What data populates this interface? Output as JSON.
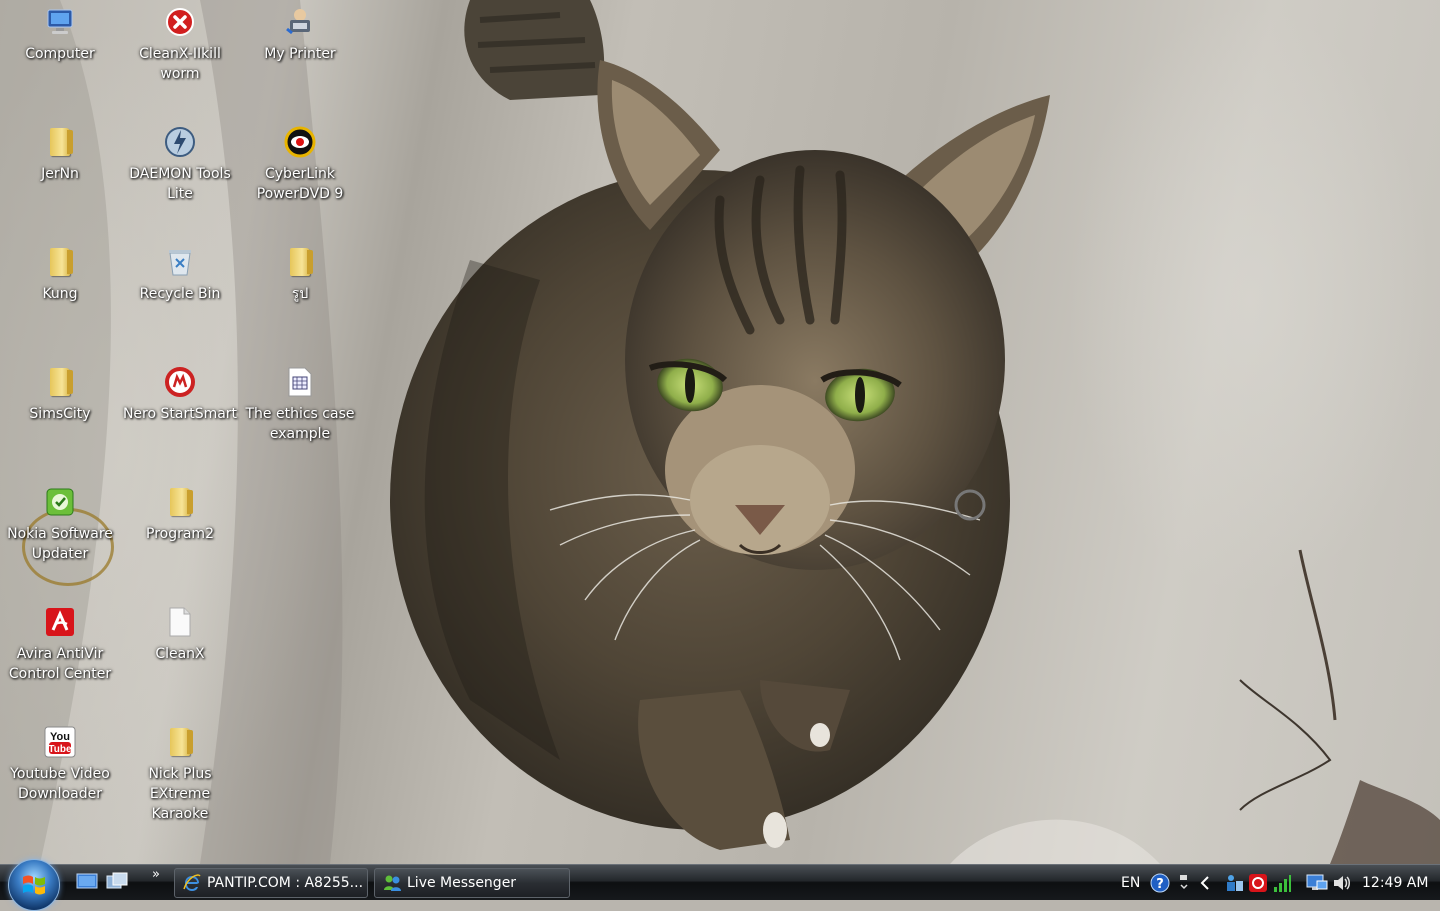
{
  "desktop": {
    "icons": [
      {
        "label": "Computer",
        "icon": "computer-icon"
      },
      {
        "label": "CleanX-IIkill worm",
        "icon": "red-x-icon"
      },
      {
        "label": "My Printer",
        "icon": "printer-icon"
      },
      {
        "label": "JerNn",
        "icon": "folder-icon"
      },
      {
        "label": "DAEMON Tools Lite",
        "icon": "daemon-tools-icon"
      },
      {
        "label": "CyberLink PowerDVD 9",
        "icon": "powerdvd-icon"
      },
      {
        "label": "Kung",
        "icon": "folder-icon"
      },
      {
        "label": "Recycle Bin",
        "icon": "recycle-bin-icon"
      },
      {
        "label": "รูป",
        "icon": "folder-icon"
      },
      {
        "label": "SimsCity",
        "icon": "folder-icon"
      },
      {
        "label": "Nero StartSmart",
        "icon": "nero-icon"
      },
      {
        "label": "The ethics case example",
        "icon": "document-icon"
      },
      {
        "label": "Nokia Software Updater",
        "icon": "nokia-updater-icon"
      },
      {
        "label": "Program2",
        "icon": "folder-icon"
      },
      {
        "label": "Avira AntiVir Control Center",
        "icon": "avira-icon"
      },
      {
        "label": "CleanX",
        "icon": "blank-file-icon"
      },
      {
        "label": "Youtube Video Downloader",
        "icon": "youtube-icon"
      },
      {
        "label": "Nick Plus EXtreme Karaoke",
        "icon": "folder-icon"
      }
    ]
  },
  "taskbar": {
    "start_button": "start-orb-icon",
    "quick_launch": [
      "show-desktop-icon",
      "switch-windows-icon"
    ],
    "overflow": "»",
    "tasks": [
      {
        "label": "PANTIP.COM : A8255...",
        "icon": "ie-icon"
      },
      {
        "label": "Live Messenger",
        "icon": "messenger-icon"
      }
    ],
    "tray": {
      "language": "EN",
      "clock": "12:49 AM"
    }
  },
  "colors": {
    "taskbar": "#1a1d20",
    "label_text": "#ffffff"
  }
}
